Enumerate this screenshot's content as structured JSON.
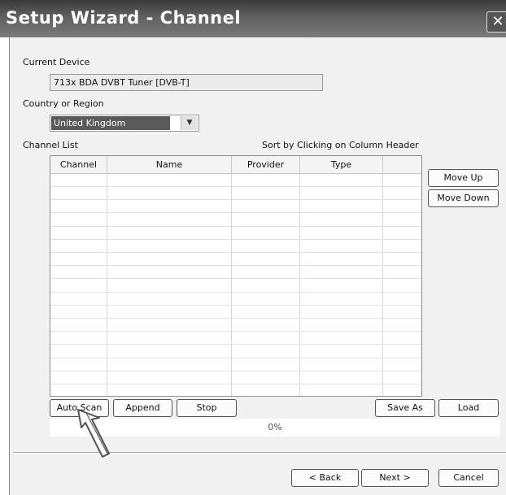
{
  "window": {
    "title": "Setup Wizard - Channel",
    "close_glyph": "✕"
  },
  "device": {
    "label": "Current Device",
    "value": "713x BDA DVBT Tuner  [DVB-T]"
  },
  "country": {
    "label": "Country or Region",
    "selected": "United Kingdom",
    "arrow_glyph": "▼"
  },
  "channel_list": {
    "label": "Channel List",
    "sort_hint": "Sort by Clicking on Column Header",
    "columns": [
      "Channel",
      "Name",
      "Provider",
      "Type",
      ""
    ],
    "rows": []
  },
  "side_buttons": {
    "move_up": "Move Up",
    "move_down": "Move Down"
  },
  "scan_buttons": {
    "auto_scan": "Auto Scan",
    "append": "Append",
    "stop": "Stop",
    "save_as": "Save As",
    "load": "Load"
  },
  "progress": {
    "percent": 0,
    "label": "0%"
  },
  "nav": {
    "back": "< Back",
    "next": "Next >",
    "cancel": "Cancel"
  },
  "colors": {
    "titlebar": "#5a5a5a",
    "selection": "#5a5a5a",
    "dialog_bg": "#f1f1f1"
  }
}
